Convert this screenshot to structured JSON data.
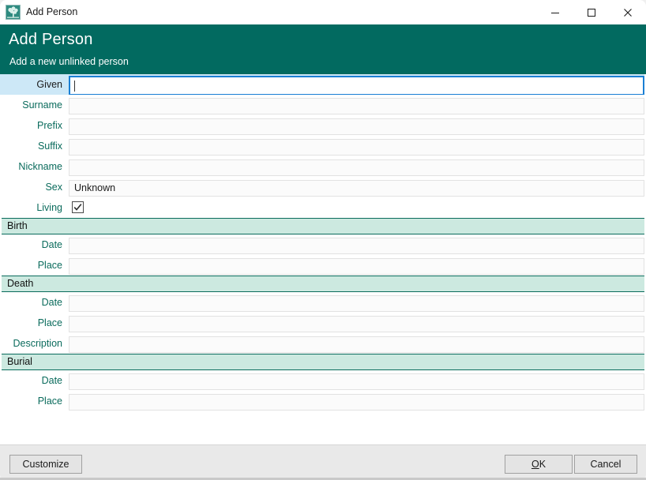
{
  "window": {
    "title": "Add Person",
    "icon": "family-tree-icon",
    "controls": {
      "minimize": "minimize-icon",
      "maximize": "maximize-icon",
      "close": "close-icon"
    }
  },
  "banner": {
    "title": "Add Person",
    "subtitle": "Add a new unlinked person",
    "bg_color": "#026a60",
    "text_color": "#ffffff"
  },
  "colors": {
    "accent_teal": "#026a60",
    "label_teal": "#0a6b5c",
    "section_bg": "#cce9e0",
    "selected_label_bg": "#cde8f7",
    "focus_border": "#1a7fd4",
    "field_bg": "#fbfbfb",
    "footer_bg": "#e9e9e9"
  },
  "form": {
    "rows": [
      {
        "label": "Given",
        "value": "",
        "type": "text",
        "selected": true,
        "focused": true
      },
      {
        "label": "Surname",
        "value": "",
        "type": "text",
        "selected": false,
        "focused": false
      },
      {
        "label": "Prefix",
        "value": "",
        "type": "text",
        "selected": false,
        "focused": false
      },
      {
        "label": "Suffix",
        "value": "",
        "type": "text",
        "selected": false,
        "focused": false
      },
      {
        "label": "Nickname",
        "value": "",
        "type": "text",
        "selected": false,
        "focused": false
      },
      {
        "label": "Sex",
        "value": "Unknown",
        "type": "text",
        "selected": false,
        "focused": false
      },
      {
        "label": "Living",
        "value": "",
        "type": "checkbox",
        "checked": true,
        "selected": false,
        "focused": false
      },
      {
        "label": "Birth",
        "type": "section"
      },
      {
        "label": "Date",
        "value": "",
        "type": "text",
        "selected": false,
        "focused": false
      },
      {
        "label": "Place",
        "value": "",
        "type": "text",
        "selected": false,
        "focused": false
      },
      {
        "label": "Death",
        "type": "section"
      },
      {
        "label": "Date",
        "value": "",
        "type": "text",
        "selected": false,
        "focused": false
      },
      {
        "label": "Place",
        "value": "",
        "type": "text",
        "selected": false,
        "focused": false
      },
      {
        "label": "Description",
        "value": "",
        "type": "text",
        "selected": false,
        "focused": false
      },
      {
        "label": "Burial",
        "type": "section"
      },
      {
        "label": "Date",
        "value": "",
        "type": "text",
        "selected": false,
        "focused": false
      },
      {
        "label": "Place",
        "value": "",
        "type": "text",
        "selected": false,
        "focused": false
      }
    ]
  },
  "footer": {
    "customize_label": "Customize",
    "ok_label": "OK",
    "ok_accel": "O",
    "ok_rest": "K",
    "cancel_label": "Cancel"
  }
}
